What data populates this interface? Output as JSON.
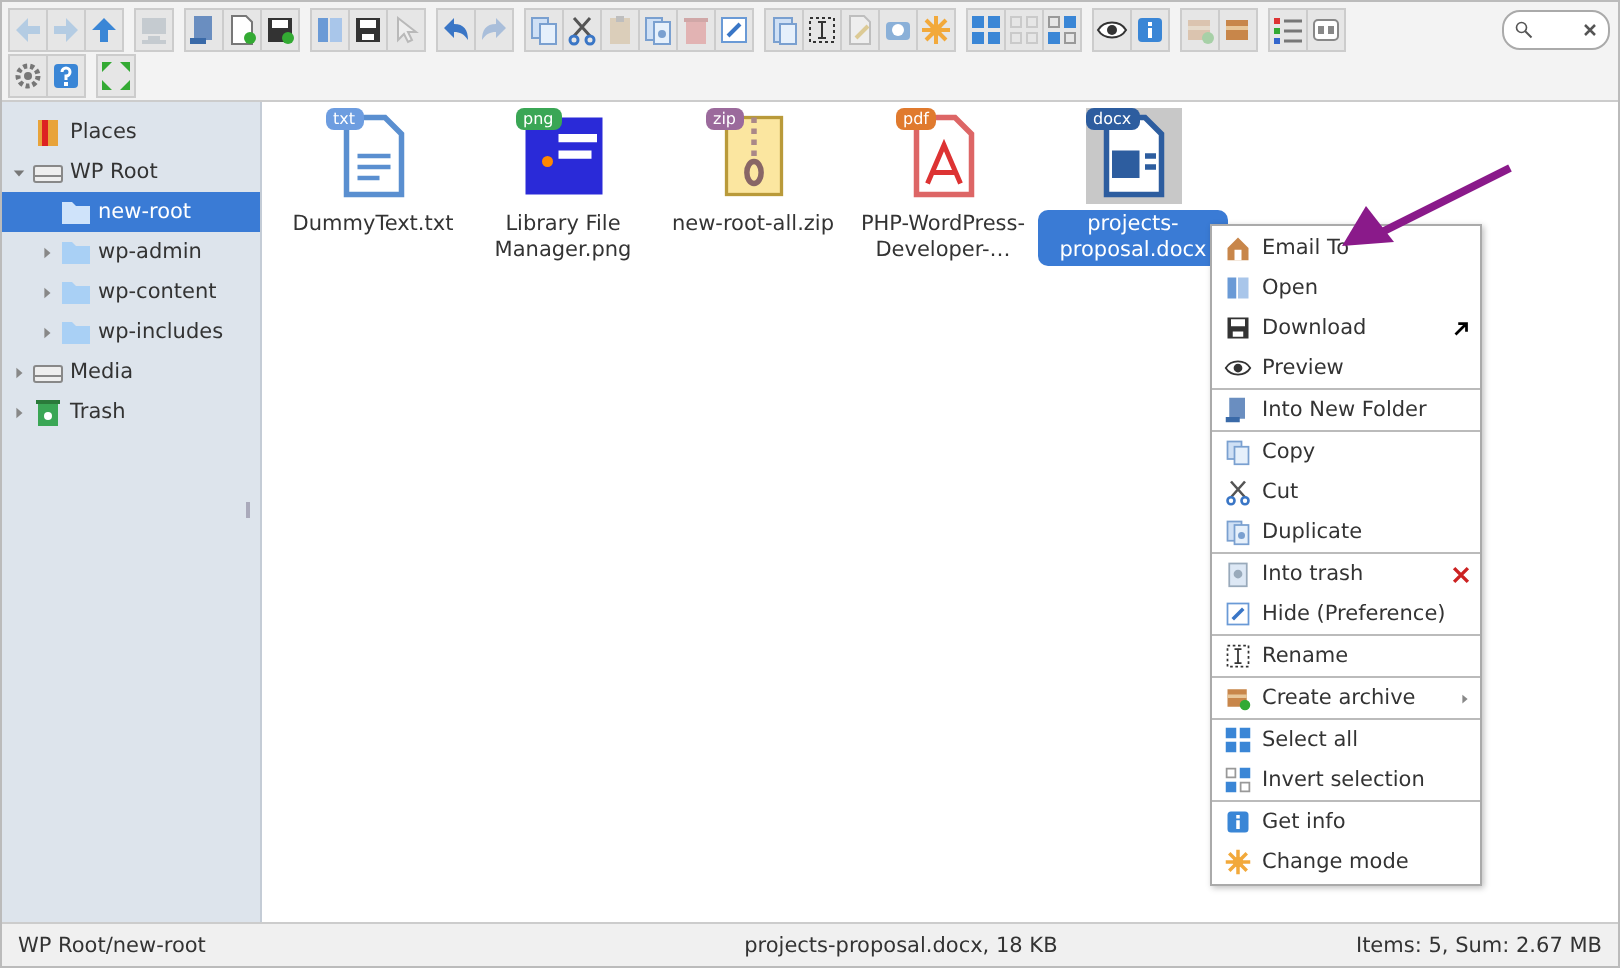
{
  "toolbar": {
    "rows": [
      [
        {
          "group": [
            {
              "disabled": true
            },
            {
              "disabled": true
            },
            {
              "disabled": false
            }
          ]
        },
        {
          "group": [
            {
              "disabled": true
            }
          ]
        },
        {
          "group": [
            {
              "disabled": false
            },
            {
              "disabled": false
            },
            {
              "disabled": false
            }
          ]
        },
        {
          "group": [
            {
              "disabled": false
            },
            {
              "disabled": false
            },
            {
              "disabled": true
            }
          ]
        },
        {
          "group": [
            {
              "disabled": false
            },
            {
              "disabled": true
            }
          ]
        },
        {
          "group": [
            {
              "disabled": false
            },
            {
              "disabled": false
            },
            {
              "disabled": true
            },
            {
              "disabled": false
            },
            {
              "disabled": true
            },
            {
              "disabled": false
            }
          ]
        },
        {
          "group": [
            {
              "disabled": false
            },
            {
              "disabled": false
            },
            {
              "disabled": true
            },
            {
              "disabled": false
            },
            {
              "disabled": false
            }
          ]
        },
        {
          "group": [
            {
              "disabled": false
            },
            {
              "disabled": true
            },
            {
              "disabled": false
            }
          ]
        },
        {
          "group": [
            {
              "disabled": false
            },
            {
              "disabled": false
            }
          ]
        },
        {
          "group": [
            {
              "disabled": true
            },
            {
              "disabled": false
            }
          ]
        },
        {
          "group": [
            {
              "disabled": false
            },
            {
              "disabled": false
            }
          ]
        }
      ],
      [
        {
          "group": [
            {
              "disabled": false
            },
            {
              "disabled": false
            }
          ]
        },
        {
          "group": [
            {
              "disabled": false
            }
          ]
        }
      ]
    ]
  },
  "tree": [
    {
      "label": "Places",
      "kind": "places",
      "expanded": false,
      "selected": false,
      "has_children": false
    },
    {
      "label": "WP Root",
      "kind": "drive",
      "expanded": true,
      "selected": false,
      "children": [
        {
          "label": "new-root",
          "kind": "folder",
          "expanded": false,
          "selected": true,
          "has_children": false
        },
        {
          "label": "wp-admin",
          "kind": "folder",
          "expanded": false,
          "selected": false,
          "has_children": true
        },
        {
          "label": "wp-content",
          "kind": "folder",
          "expanded": false,
          "selected": false,
          "has_children": true
        },
        {
          "label": "wp-includes",
          "kind": "folder",
          "expanded": false,
          "selected": false,
          "has_children": true
        }
      ]
    },
    {
      "label": "Media",
      "kind": "drive",
      "expanded": false,
      "selected": false,
      "has_children": true
    },
    {
      "label": "Trash",
      "kind": "trash",
      "expanded": false,
      "selected": false,
      "has_children": true
    }
  ],
  "files": [
    {
      "name": "DummyText.txt",
      "kind": "text",
      "badge": "txt",
      "color": "#6d9de0",
      "selected": false
    },
    {
      "name": "Library File Manager.png",
      "kind": "image",
      "badge": "png",
      "color": "#3aa655",
      "selected": false
    },
    {
      "name": "new-root-all.zip",
      "kind": "archive",
      "badge": "zip",
      "color": "#9b6a9c",
      "selected": false
    },
    {
      "name": "PHP-WordPress-Developer-…",
      "kind": "pdf",
      "badge": "pdf",
      "color": "#e07a2e",
      "selected": false
    },
    {
      "name": "projects-proposal.docx",
      "kind": "word",
      "badge": "docx",
      "color": "#2d5d9f",
      "selected": true
    }
  ],
  "context_menu": [
    {
      "kind": "item",
      "label": "Email To"
    },
    {
      "kind": "item",
      "label": "Open"
    },
    {
      "kind": "item",
      "label": "Download"
    },
    {
      "kind": "item",
      "label": "Preview"
    },
    {
      "kind": "separator"
    },
    {
      "kind": "item",
      "label": "Into New Folder"
    },
    {
      "kind": "separator"
    },
    {
      "kind": "item",
      "label": "Copy"
    },
    {
      "kind": "item",
      "label": "Cut"
    },
    {
      "kind": "item",
      "label": "Duplicate"
    },
    {
      "kind": "separator"
    },
    {
      "kind": "item",
      "label": "Into trash"
    },
    {
      "kind": "item",
      "label": "Hide (Preference)"
    },
    {
      "kind": "separator"
    },
    {
      "kind": "item",
      "label": "Rename"
    },
    {
      "kind": "separator"
    },
    {
      "kind": "item",
      "label": "Create archive",
      "submenu": true
    },
    {
      "kind": "separator"
    },
    {
      "kind": "item",
      "label": "Select all"
    },
    {
      "kind": "item",
      "label": "Invert selection"
    },
    {
      "kind": "separator"
    },
    {
      "kind": "item",
      "label": "Get info"
    },
    {
      "kind": "item",
      "label": "Change mode"
    }
  ],
  "status_bar": {
    "path": "WP Root/new-root",
    "selection": "projects-proposal.docx, 18 KB",
    "summary": "Items: 5, Sum: 2.67 MB"
  }
}
